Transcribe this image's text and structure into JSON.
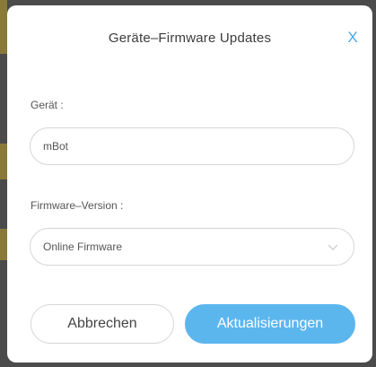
{
  "dialog": {
    "title": "Geräte–Firmware Updates",
    "close_label": "X"
  },
  "device": {
    "label": "Gerät :",
    "value": "mBot"
  },
  "firmware": {
    "label": "Firmware–Version :",
    "selected": "Online Firmware"
  },
  "buttons": {
    "cancel_label": "Abbrechen",
    "update_label": "Aktualisierungen"
  },
  "colors": {
    "accent": "#5cb6ee",
    "close": "#4aa8e8"
  },
  "icons": {
    "dropdown": "chevron-down-icon"
  }
}
